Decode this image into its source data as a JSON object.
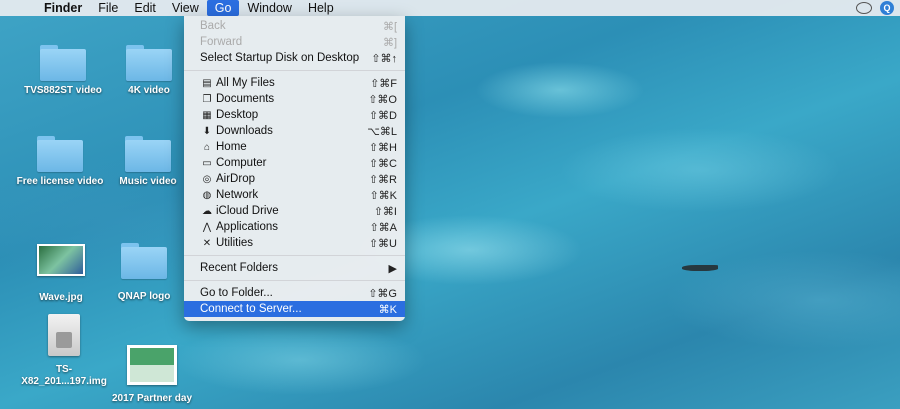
{
  "menubar": {
    "apple": "",
    "items": [
      "Finder",
      "File",
      "Edit",
      "View",
      "Go",
      "Window",
      "Help"
    ]
  },
  "desktop": {
    "icons": [
      {
        "label": "TVS882ST video",
        "kind": "folder"
      },
      {
        "label": "4K video",
        "kind": "folder"
      },
      {
        "label": "Free license video",
        "kind": "folder"
      },
      {
        "label": "Music video",
        "kind": "folder"
      },
      {
        "label": "Wave.jpg",
        "kind": "image"
      },
      {
        "label": "QNAP logo",
        "kind": "folder"
      },
      {
        "label": "TS-X82_201...197.img",
        "kind": "disk-image"
      },
      {
        "label": "2017 Partner day",
        "kind": "document"
      }
    ]
  },
  "go_menu": {
    "group1": [
      {
        "label": "Back",
        "shortcut": "⌘[",
        "disabled": true
      },
      {
        "label": "Forward",
        "shortcut": "⌘]",
        "disabled": true
      },
      {
        "label": "Select Startup Disk on Desktop",
        "shortcut": "⇧⌘↑"
      }
    ],
    "group2": [
      {
        "label": "All My Files",
        "shortcut": "⇧⌘F",
        "icon": "all-files-icon"
      },
      {
        "label": "Documents",
        "shortcut": "⇧⌘O",
        "icon": "documents-icon"
      },
      {
        "label": "Desktop",
        "shortcut": "⇧⌘D",
        "icon": "desktop-icon"
      },
      {
        "label": "Downloads",
        "shortcut": "⌥⌘L",
        "icon": "downloads-icon"
      },
      {
        "label": "Home",
        "shortcut": "⇧⌘H",
        "icon": "home-icon"
      },
      {
        "label": "Computer",
        "shortcut": "⇧⌘C",
        "icon": "computer-icon"
      },
      {
        "label": "AirDrop",
        "shortcut": "⇧⌘R",
        "icon": "airdrop-icon"
      },
      {
        "label": "Network",
        "shortcut": "⇧⌘K",
        "icon": "network-icon"
      },
      {
        "label": "iCloud Drive",
        "shortcut": "⇧⌘I",
        "icon": "icloud-icon"
      },
      {
        "label": "Applications",
        "shortcut": "⇧⌘A",
        "icon": "applications-icon"
      },
      {
        "label": "Utilities",
        "shortcut": "⇧⌘U",
        "icon": "utilities-icon"
      }
    ],
    "recent_folders": "Recent Folders",
    "group4": [
      {
        "label": "Go to Folder...",
        "shortcut": "⇧⌘G"
      },
      {
        "label": "Connect to Server...",
        "shortcut": "⌘K",
        "highlighted": true
      }
    ]
  },
  "colors": {
    "highlight": "#2b6ee0",
    "folder": "#8ccdf3"
  }
}
